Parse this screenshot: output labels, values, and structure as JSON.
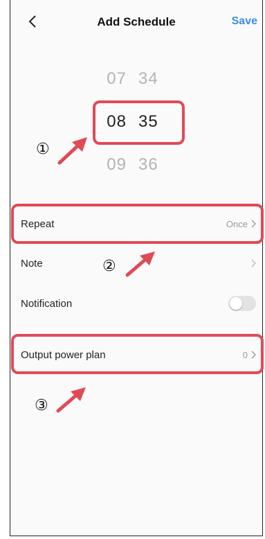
{
  "header": {
    "title": "Add Schedule",
    "save_label": "Save"
  },
  "time_picker": {
    "prev_hour": "07",
    "prev_minute": "34",
    "hour": "08",
    "minute": "35",
    "next_hour": "09",
    "next_minute": "36"
  },
  "settings": {
    "repeat_label": "Repeat",
    "repeat_value": "Once",
    "note_label": "Note",
    "note_value": "",
    "notification_label": "Notification",
    "output_plan_label": "Output power plan",
    "output_plan_value": "0"
  },
  "annotations": {
    "marker_1": "①",
    "marker_2": "②",
    "marker_3": "③"
  },
  "colors": {
    "accent": "#3d8ee6",
    "highlight": "#e04a55"
  }
}
